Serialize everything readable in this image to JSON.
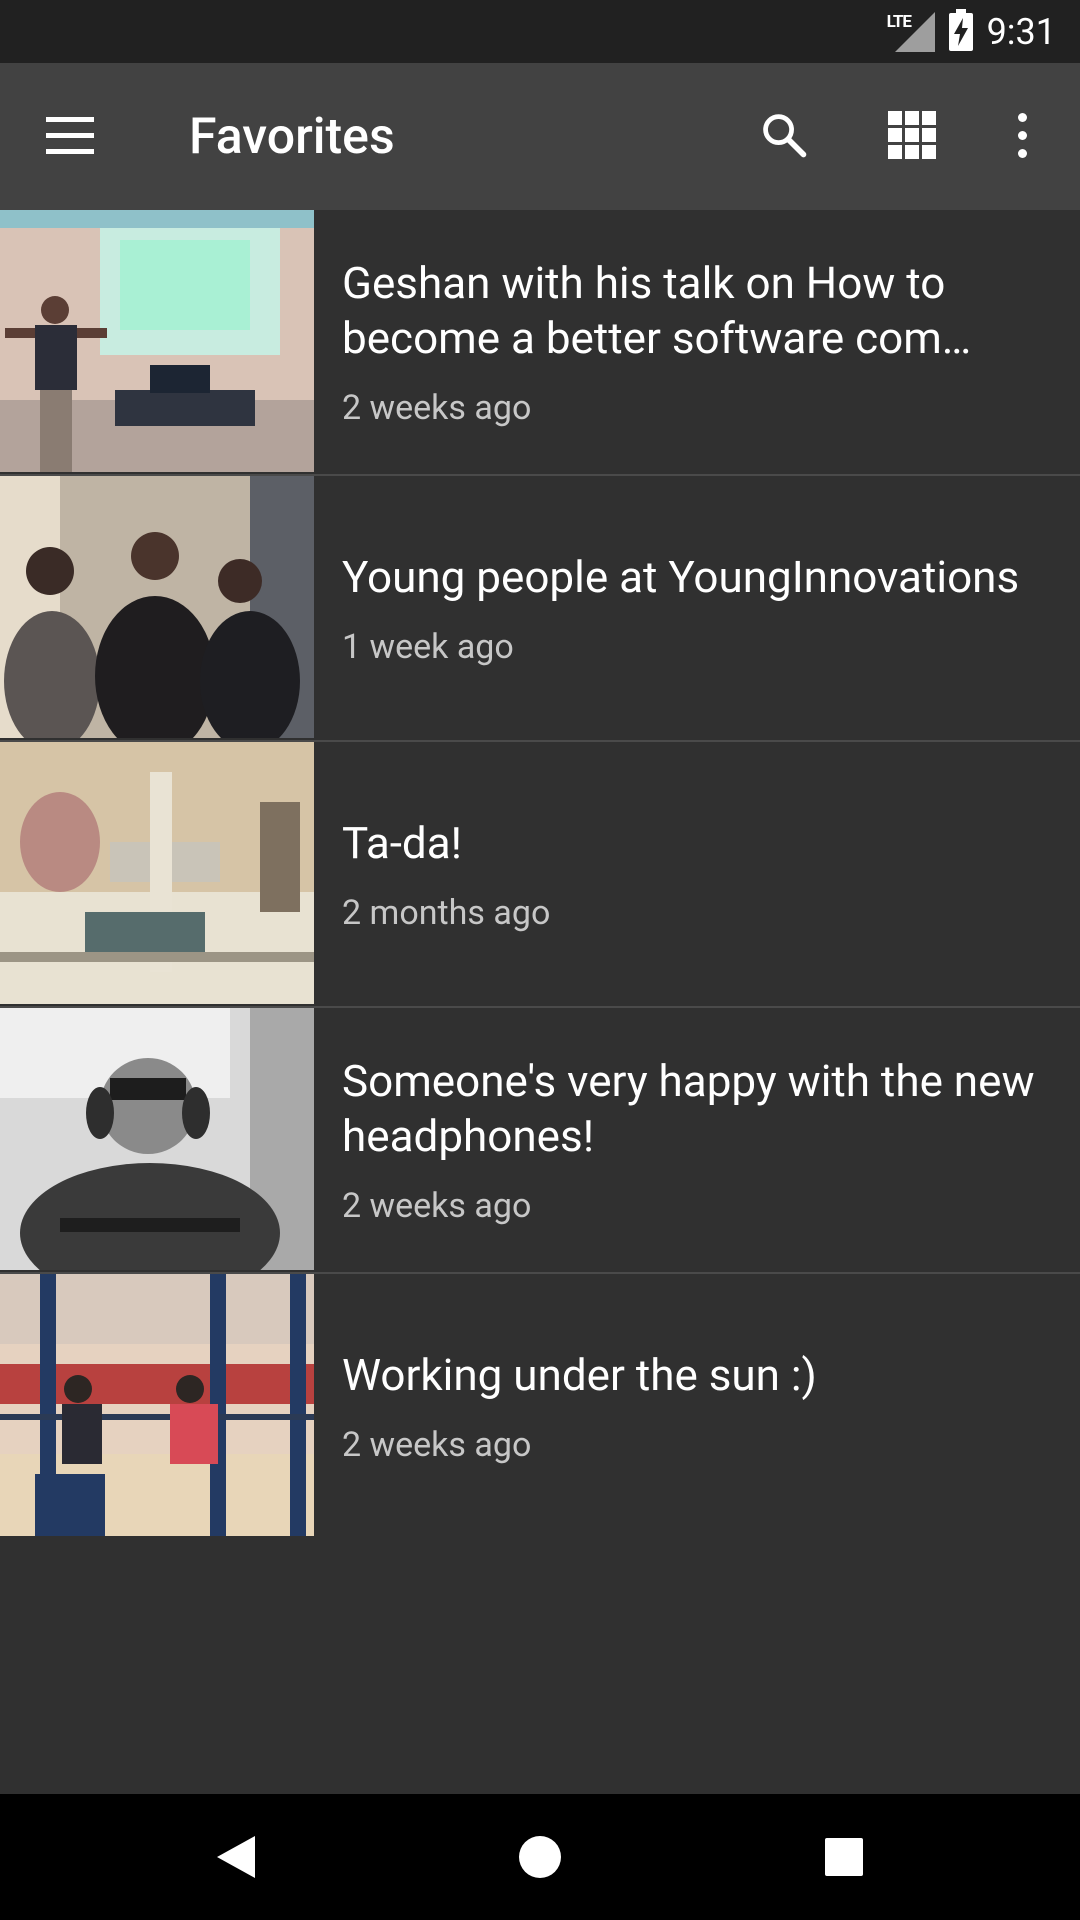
{
  "status_bar": {
    "network_label": "LTE",
    "time": "9:31"
  },
  "toolbar": {
    "title": "Favorites"
  },
  "items": [
    {
      "title": "Geshan with his talk on How to become a better software com…",
      "time": "2 weeks ago"
    },
    {
      "title": "Young people at YoungInnovations",
      "time": "1 week ago"
    },
    {
      "title": "Ta-da!",
      "time": "2 months ago"
    },
    {
      "title": "Someone's very happy with the new headphones!",
      "time": "2 weeks ago"
    },
    {
      "title": "Working under the sun :)",
      "time": "2 weeks ago"
    }
  ],
  "icons": {
    "menu": "menu-icon",
    "search": "search-icon",
    "grid": "grid-view-icon",
    "more": "more-vert-icon",
    "back": "back-icon",
    "home": "home-icon",
    "recents": "recents-icon"
  },
  "colors": {
    "background": "#303030",
    "toolbar": "#424242",
    "status_bar": "#212121",
    "secondary_text": "#c7c7c7"
  }
}
